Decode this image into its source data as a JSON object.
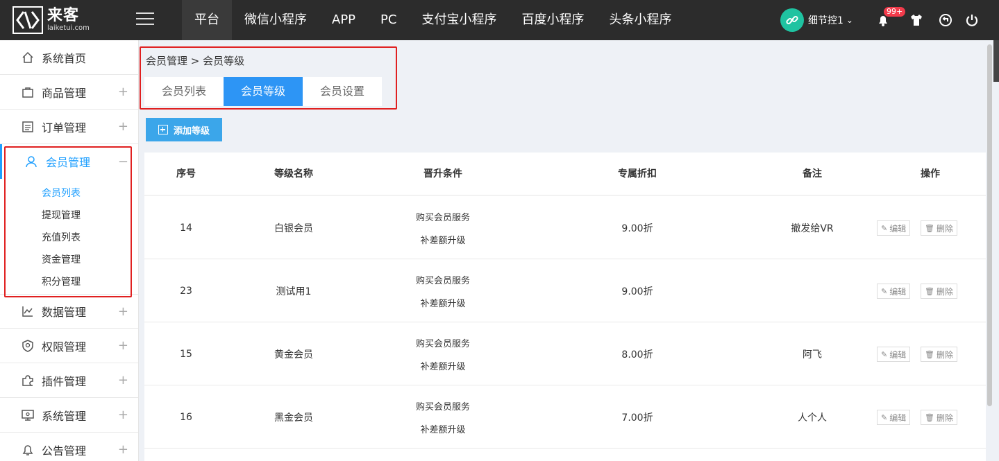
{
  "topbar": {
    "logo_cn": "来客",
    "logo_en": "laiketui.com",
    "nav": [
      "平台",
      "微信小程序",
      "APP",
      "PC",
      "支付宝小程序",
      "百度小程序",
      "头条小程序"
    ],
    "user_name": "细节控1",
    "notification_badge": "99+"
  },
  "sidebar": {
    "items": [
      {
        "label": "系统首页",
        "icon": "home-icon"
      },
      {
        "label": "商品管理",
        "icon": "bag-icon"
      },
      {
        "label": "订单管理",
        "icon": "order-icon"
      },
      {
        "label": "会员管理",
        "icon": "user-icon"
      },
      {
        "label": "数据管理",
        "icon": "chart-icon"
      },
      {
        "label": "权限管理",
        "icon": "shield-icon"
      },
      {
        "label": "插件管理",
        "icon": "puzzle-icon"
      },
      {
        "label": "系统管理",
        "icon": "monitor-icon"
      },
      {
        "label": "公告管理",
        "icon": "bell-icon"
      }
    ],
    "sub_items": [
      "会员列表",
      "提现管理",
      "充值列表",
      "资金管理",
      "积分管理"
    ]
  },
  "breadcrumb": "会员管理 > 会员等级",
  "tabs": [
    "会员列表",
    "会员等级",
    "会员设置"
  ],
  "add_button": "添加等级",
  "table": {
    "headers": [
      "序号",
      "等级名称",
      "晋升条件",
      "专属折扣",
      "备注",
      "操作"
    ],
    "rows": [
      {
        "id": "14",
        "name": "白银会员",
        "cond1": "购买会员服务",
        "cond2": "补差额升级",
        "discount": "9.00折",
        "note": "撤发给VR"
      },
      {
        "id": "23",
        "name": "测试用1",
        "cond1": "购买会员服务",
        "cond2": "补差额升级",
        "discount": "9.00折",
        "note": ""
      },
      {
        "id": "15",
        "name": "黄金会员",
        "cond1": "购买会员服务",
        "cond2": "补差额升级",
        "discount": "8.00折",
        "note": "阿飞"
      },
      {
        "id": "16",
        "name": "黑金会员",
        "cond1": "购买会员服务",
        "cond2": "补差额升级",
        "discount": "7.00折",
        "note": "人个人"
      }
    ],
    "edit_label": "编辑",
    "delete_label": "删除"
  },
  "colors": {
    "accent": "#1e9fff",
    "tab_active": "#2d95f5",
    "add_button": "#3ba6ea",
    "highlight_box": "#e02020",
    "topbar": "#2c2c2c"
  }
}
